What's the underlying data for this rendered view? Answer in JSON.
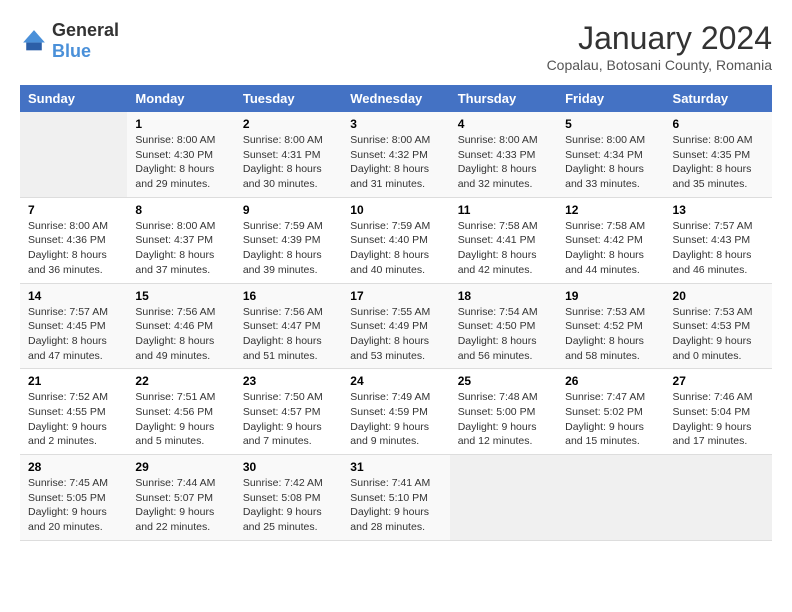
{
  "header": {
    "logo_general": "General",
    "logo_blue": "Blue",
    "title": "January 2024",
    "subtitle": "Copalau, Botosani County, Romania"
  },
  "days_of_week": [
    "Sunday",
    "Monday",
    "Tuesday",
    "Wednesday",
    "Thursday",
    "Friday",
    "Saturday"
  ],
  "weeks": [
    [
      {
        "day": "",
        "empty": true
      },
      {
        "day": "1",
        "sunrise": "Sunrise: 8:00 AM",
        "sunset": "Sunset: 4:30 PM",
        "daylight": "Daylight: 8 hours and 29 minutes."
      },
      {
        "day": "2",
        "sunrise": "Sunrise: 8:00 AM",
        "sunset": "Sunset: 4:31 PM",
        "daylight": "Daylight: 8 hours and 30 minutes."
      },
      {
        "day": "3",
        "sunrise": "Sunrise: 8:00 AM",
        "sunset": "Sunset: 4:32 PM",
        "daylight": "Daylight: 8 hours and 31 minutes."
      },
      {
        "day": "4",
        "sunrise": "Sunrise: 8:00 AM",
        "sunset": "Sunset: 4:33 PM",
        "daylight": "Daylight: 8 hours and 32 minutes."
      },
      {
        "day": "5",
        "sunrise": "Sunrise: 8:00 AM",
        "sunset": "Sunset: 4:34 PM",
        "daylight": "Daylight: 8 hours and 33 minutes."
      },
      {
        "day": "6",
        "sunrise": "Sunrise: 8:00 AM",
        "sunset": "Sunset: 4:35 PM",
        "daylight": "Daylight: 8 hours and 35 minutes."
      }
    ],
    [
      {
        "day": "7",
        "sunrise": "Sunrise: 8:00 AM",
        "sunset": "Sunset: 4:36 PM",
        "daylight": "Daylight: 8 hours and 36 minutes."
      },
      {
        "day": "8",
        "sunrise": "Sunrise: 8:00 AM",
        "sunset": "Sunset: 4:37 PM",
        "daylight": "Daylight: 8 hours and 37 minutes."
      },
      {
        "day": "9",
        "sunrise": "Sunrise: 7:59 AM",
        "sunset": "Sunset: 4:39 PM",
        "daylight": "Daylight: 8 hours and 39 minutes."
      },
      {
        "day": "10",
        "sunrise": "Sunrise: 7:59 AM",
        "sunset": "Sunset: 4:40 PM",
        "daylight": "Daylight: 8 hours and 40 minutes."
      },
      {
        "day": "11",
        "sunrise": "Sunrise: 7:58 AM",
        "sunset": "Sunset: 4:41 PM",
        "daylight": "Daylight: 8 hours and 42 minutes."
      },
      {
        "day": "12",
        "sunrise": "Sunrise: 7:58 AM",
        "sunset": "Sunset: 4:42 PM",
        "daylight": "Daylight: 8 hours and 44 minutes."
      },
      {
        "day": "13",
        "sunrise": "Sunrise: 7:57 AM",
        "sunset": "Sunset: 4:43 PM",
        "daylight": "Daylight: 8 hours and 46 minutes."
      }
    ],
    [
      {
        "day": "14",
        "sunrise": "Sunrise: 7:57 AM",
        "sunset": "Sunset: 4:45 PM",
        "daylight": "Daylight: 8 hours and 47 minutes."
      },
      {
        "day": "15",
        "sunrise": "Sunrise: 7:56 AM",
        "sunset": "Sunset: 4:46 PM",
        "daylight": "Daylight: 8 hours and 49 minutes."
      },
      {
        "day": "16",
        "sunrise": "Sunrise: 7:56 AM",
        "sunset": "Sunset: 4:47 PM",
        "daylight": "Daylight: 8 hours and 51 minutes."
      },
      {
        "day": "17",
        "sunrise": "Sunrise: 7:55 AM",
        "sunset": "Sunset: 4:49 PM",
        "daylight": "Daylight: 8 hours and 53 minutes."
      },
      {
        "day": "18",
        "sunrise": "Sunrise: 7:54 AM",
        "sunset": "Sunset: 4:50 PM",
        "daylight": "Daylight: 8 hours and 56 minutes."
      },
      {
        "day": "19",
        "sunrise": "Sunrise: 7:53 AM",
        "sunset": "Sunset: 4:52 PM",
        "daylight": "Daylight: 8 hours and 58 minutes."
      },
      {
        "day": "20",
        "sunrise": "Sunrise: 7:53 AM",
        "sunset": "Sunset: 4:53 PM",
        "daylight": "Daylight: 9 hours and 0 minutes."
      }
    ],
    [
      {
        "day": "21",
        "sunrise": "Sunrise: 7:52 AM",
        "sunset": "Sunset: 4:55 PM",
        "daylight": "Daylight: 9 hours and 2 minutes."
      },
      {
        "day": "22",
        "sunrise": "Sunrise: 7:51 AM",
        "sunset": "Sunset: 4:56 PM",
        "daylight": "Daylight: 9 hours and 5 minutes."
      },
      {
        "day": "23",
        "sunrise": "Sunrise: 7:50 AM",
        "sunset": "Sunset: 4:57 PM",
        "daylight": "Daylight: 9 hours and 7 minutes."
      },
      {
        "day": "24",
        "sunrise": "Sunrise: 7:49 AM",
        "sunset": "Sunset: 4:59 PM",
        "daylight": "Daylight: 9 hours and 9 minutes."
      },
      {
        "day": "25",
        "sunrise": "Sunrise: 7:48 AM",
        "sunset": "Sunset: 5:00 PM",
        "daylight": "Daylight: 9 hours and 12 minutes."
      },
      {
        "day": "26",
        "sunrise": "Sunrise: 7:47 AM",
        "sunset": "Sunset: 5:02 PM",
        "daylight": "Daylight: 9 hours and 15 minutes."
      },
      {
        "day": "27",
        "sunrise": "Sunrise: 7:46 AM",
        "sunset": "Sunset: 5:04 PM",
        "daylight": "Daylight: 9 hours and 17 minutes."
      }
    ],
    [
      {
        "day": "28",
        "sunrise": "Sunrise: 7:45 AM",
        "sunset": "Sunset: 5:05 PM",
        "daylight": "Daylight: 9 hours and 20 minutes."
      },
      {
        "day": "29",
        "sunrise": "Sunrise: 7:44 AM",
        "sunset": "Sunset: 5:07 PM",
        "daylight": "Daylight: 9 hours and 22 minutes."
      },
      {
        "day": "30",
        "sunrise": "Sunrise: 7:42 AM",
        "sunset": "Sunset: 5:08 PM",
        "daylight": "Daylight: 9 hours and 25 minutes."
      },
      {
        "day": "31",
        "sunrise": "Sunrise: 7:41 AM",
        "sunset": "Sunset: 5:10 PM",
        "daylight": "Daylight: 9 hours and 28 minutes."
      },
      {
        "day": "",
        "empty": true
      },
      {
        "day": "",
        "empty": true
      },
      {
        "day": "",
        "empty": true
      }
    ]
  ]
}
